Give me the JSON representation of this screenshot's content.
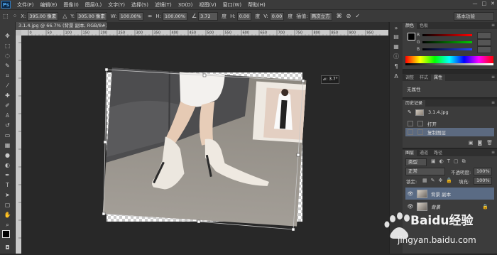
{
  "app": {
    "logo": "Ps"
  },
  "menubar": {
    "items": [
      "文件(F)",
      "编辑(E)",
      "图像(I)",
      "图层(L)",
      "文字(Y)",
      "选择(S)",
      "滤镜(T)",
      "3D(D)",
      "视图(V)",
      "窗口(W)",
      "帮助(H)"
    ],
    "window_controls": [
      "—",
      "□",
      "✕"
    ]
  },
  "options": {
    "x_label": "X:",
    "x_value": "395.00 像素",
    "y_label": "Y:",
    "y_value": "305.00 像素",
    "w_label": "W:",
    "w_value": "100.00%",
    "h_label": "H:",
    "h_value": "100.00%",
    "angle_value": "3.72",
    "angle_unit": "度",
    "hskew_label": "H:",
    "hskew_value": "0.00",
    "hskew_unit": "度",
    "vskew_label": "V:",
    "vskew_value": "0.00",
    "vskew_unit": "度",
    "interp_label": "插值:",
    "interp_value": "两次立方",
    "workspace": "基本功能"
  },
  "document": {
    "tab_label": "3.1.4.jpg @ 66.7% (背景 副本, RGB/8#) *",
    "tab_close": "×",
    "rotation_readout": "⊿: 3.7°"
  },
  "ruler": {
    "h_ticks": [
      "0",
      "50",
      "100",
      "150",
      "200",
      "250",
      "300",
      "350",
      "400",
      "450",
      "500",
      "550",
      "600",
      "650",
      "700",
      "750",
      "800",
      "850",
      "900",
      "950"
    ]
  },
  "color_panel": {
    "tabs": [
      "颜色",
      "色板"
    ],
    "channels": [
      {
        "label": "R",
        "color": "#ff0000"
      },
      {
        "label": "G",
        "color": "#00c000"
      },
      {
        "label": "B",
        "color": "#2040ff"
      }
    ]
  },
  "adjust_panel": {
    "tabs": [
      "调整",
      "样式",
      "属性"
    ],
    "content": "无属性"
  },
  "history_panel": {
    "tab": "历史记录",
    "snapshot": "3.1.4.jpg",
    "items": [
      "打开",
      "复制图层"
    ]
  },
  "layers_panel": {
    "tabs": [
      "图层",
      "通道",
      "路径"
    ],
    "filter_label": "类型",
    "blend_mode": "正常",
    "opacity_label": "不透明度:",
    "opacity_value": "100%",
    "lock_label": "锁定:",
    "fill_label": "填充:",
    "fill_value": "100%",
    "layers": [
      {
        "name": "背景 副本",
        "selected": true
      },
      {
        "name": "背景",
        "selected": false
      }
    ]
  },
  "colors": {
    "accent": "#5a6b84",
    "panel_bg": "#3c3c3c",
    "canvas_bg": "#282828"
  },
  "watermark": {
    "brand": "Baidu经验",
    "url": "jingyan.baidu.com"
  }
}
